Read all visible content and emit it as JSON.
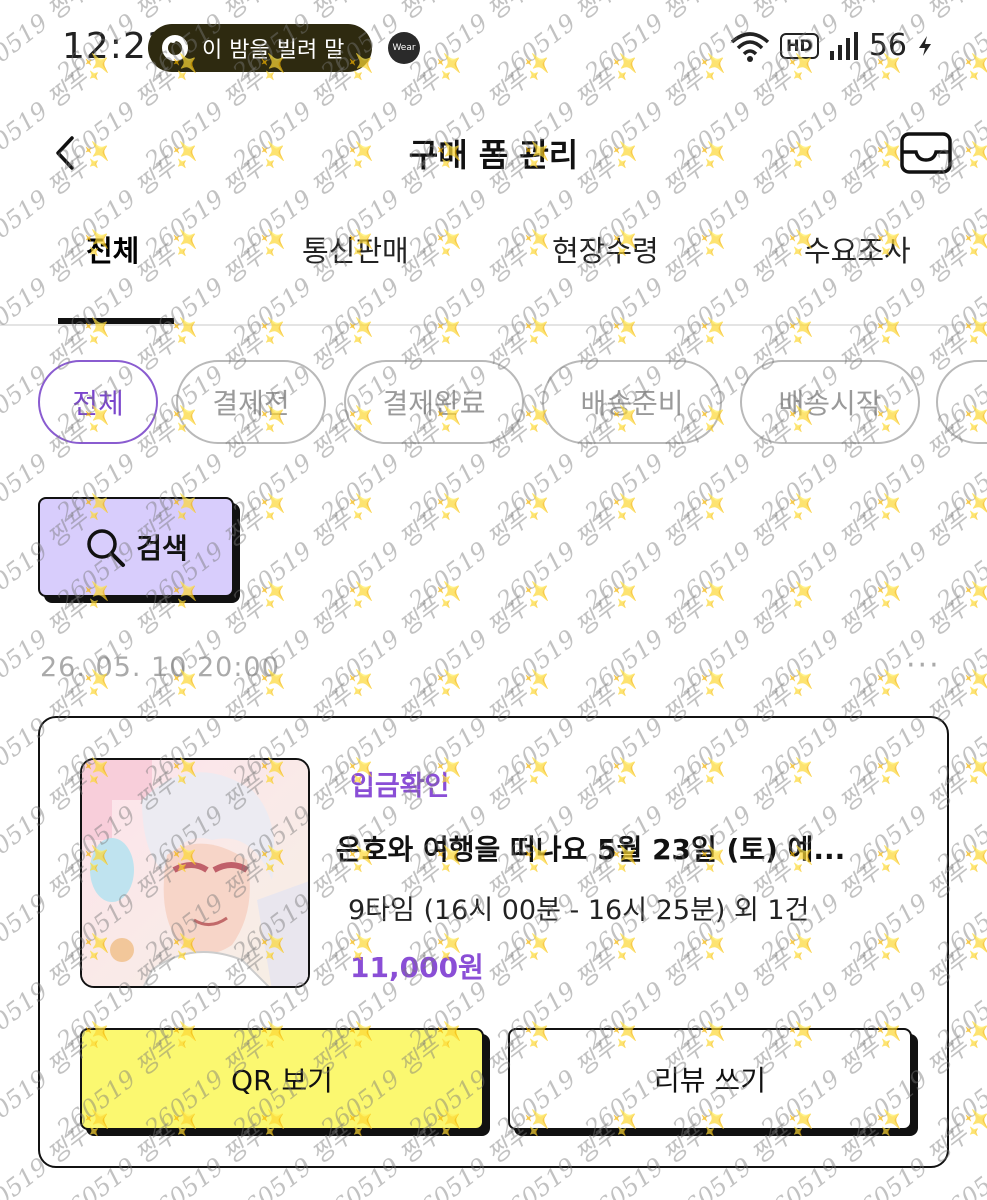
{
  "status_bar": {
    "time": "12:23",
    "now_playing": "이 밤을 빌려 말",
    "wear_badge": "Wear",
    "network_badge": "HD",
    "battery": "56"
  },
  "header": {
    "title": "구매 폼 관리"
  },
  "tabs": [
    {
      "label": "전체",
      "active": true
    },
    {
      "label": "통신판매",
      "active": false
    },
    {
      "label": "현장수령",
      "active": false
    },
    {
      "label": "수요조사",
      "active": false
    }
  ],
  "filters": [
    {
      "label": "전체",
      "active": true
    },
    {
      "label": "결제전",
      "active": false
    },
    {
      "label": "결제완료",
      "active": false
    },
    {
      "label": "배송준비",
      "active": false
    },
    {
      "label": "배송시작",
      "active": false
    },
    {
      "label": "",
      "active": false
    }
  ],
  "search": {
    "label": "검색"
  },
  "order": {
    "date": "26. 05. 10 20:00",
    "more": "···",
    "status": "입금확인",
    "name": "은호와 여행을 떠나요 5월 23일 (토) 예...",
    "time_slot": "9타임 (16시 00분 - 16시 25분) 외 1건",
    "price": "11,000원",
    "qr_label": "QR 보기",
    "review_label": "리뷰 쓰기"
  },
  "watermark": {
    "text": "260519 찡푸",
    "star": "✨"
  },
  "colors": {
    "accent": "#8a4ed6",
    "search_bg": "#d8cdfc",
    "qr_bg": "#fbf870"
  }
}
